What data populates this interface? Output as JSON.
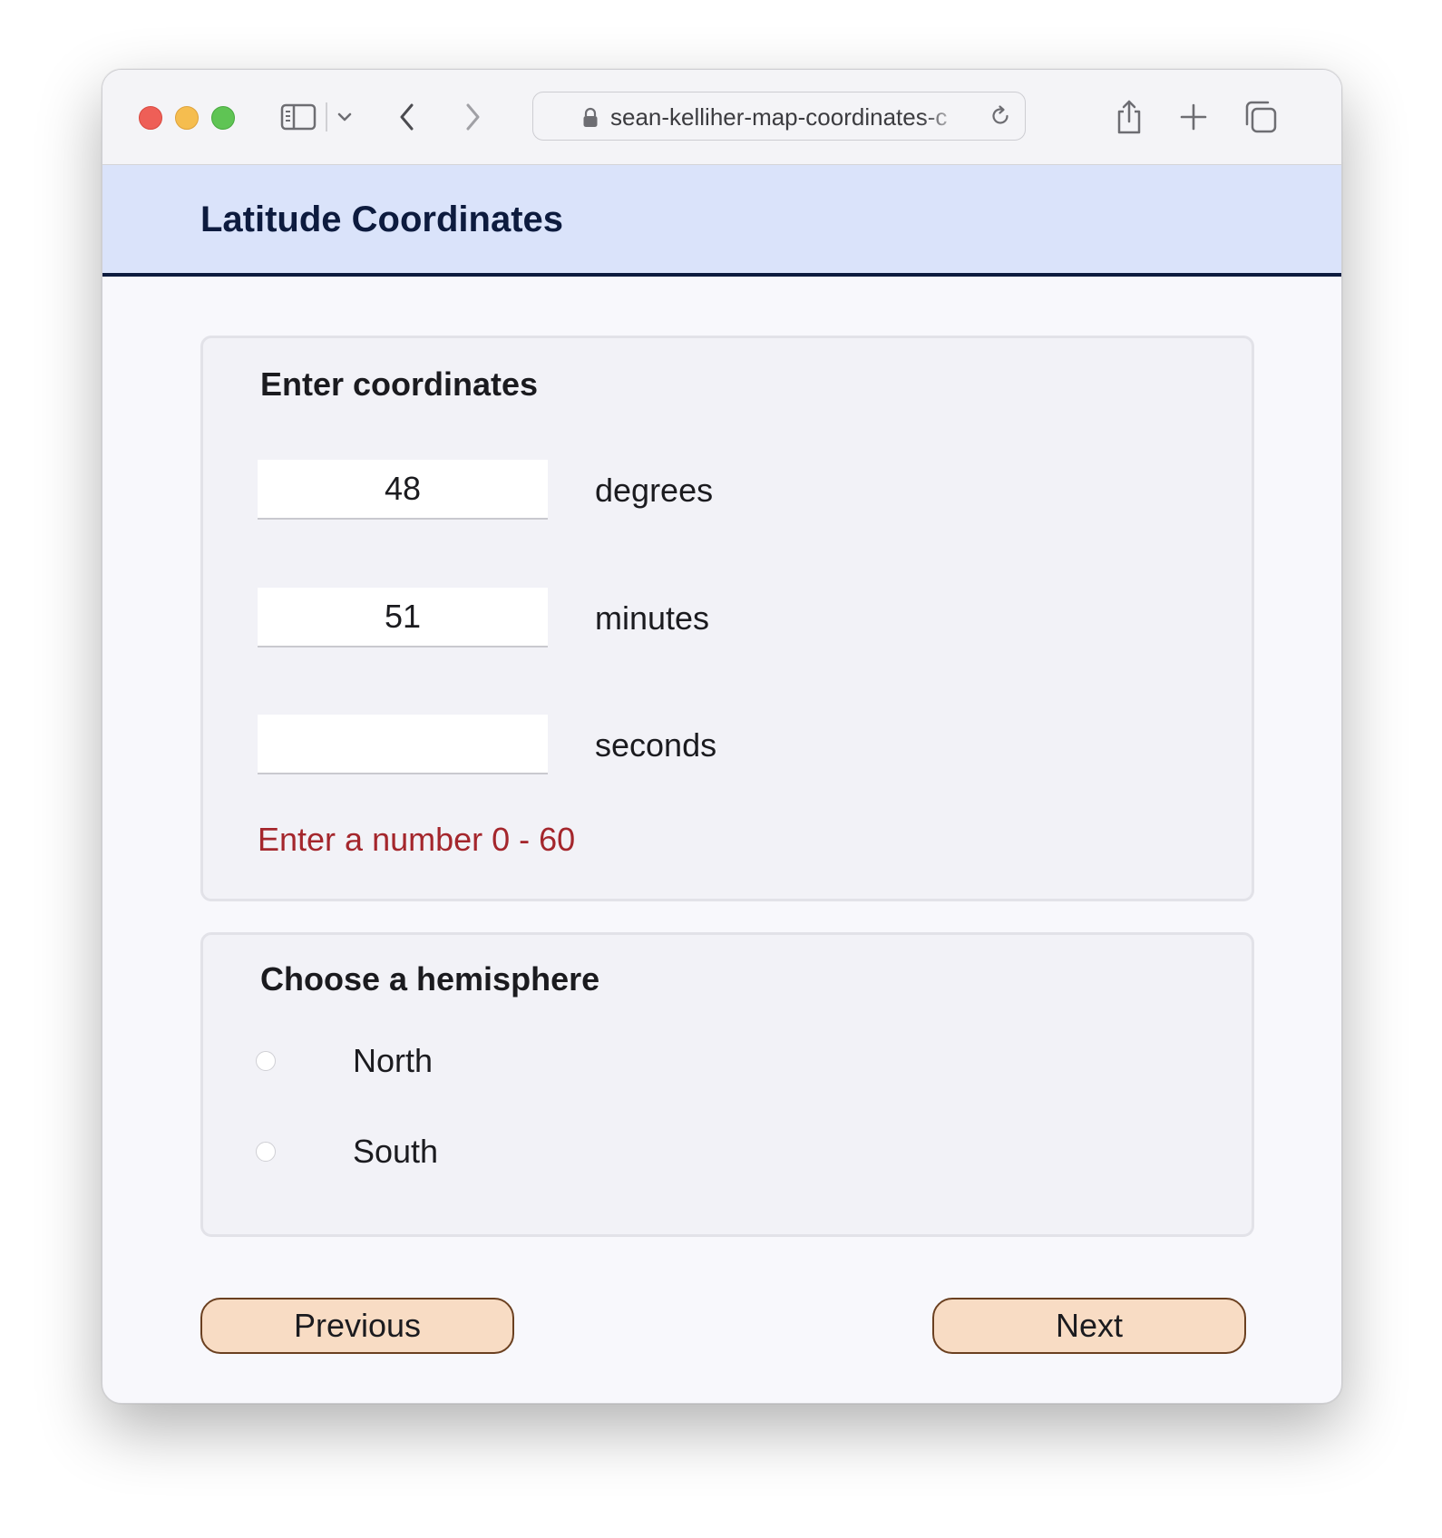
{
  "browser": {
    "url": "sean-kelliher-map-coordinates-c"
  },
  "page": {
    "title": "Latitude Coordinates"
  },
  "coordinates": {
    "heading": "Enter coordinates",
    "degrees": {
      "value": "48",
      "label": "degrees"
    },
    "minutes": {
      "value": "51",
      "label": "minutes"
    },
    "seconds": {
      "value": "",
      "label": "seconds"
    },
    "error": "Enter a number 0 - 60"
  },
  "hemisphere": {
    "heading": "Choose a hemisphere",
    "options": [
      {
        "label": "North",
        "selected": false
      },
      {
        "label": "South",
        "selected": false
      }
    ]
  },
  "nav": {
    "previous_label": "Previous",
    "next_label": "Next"
  },
  "colors": {
    "header_bg": "#dae3fa",
    "header_text": "#0d1b3e",
    "error_text": "#a4262c",
    "button_bg": "#f8dcc4",
    "button_border": "#6b4020"
  }
}
